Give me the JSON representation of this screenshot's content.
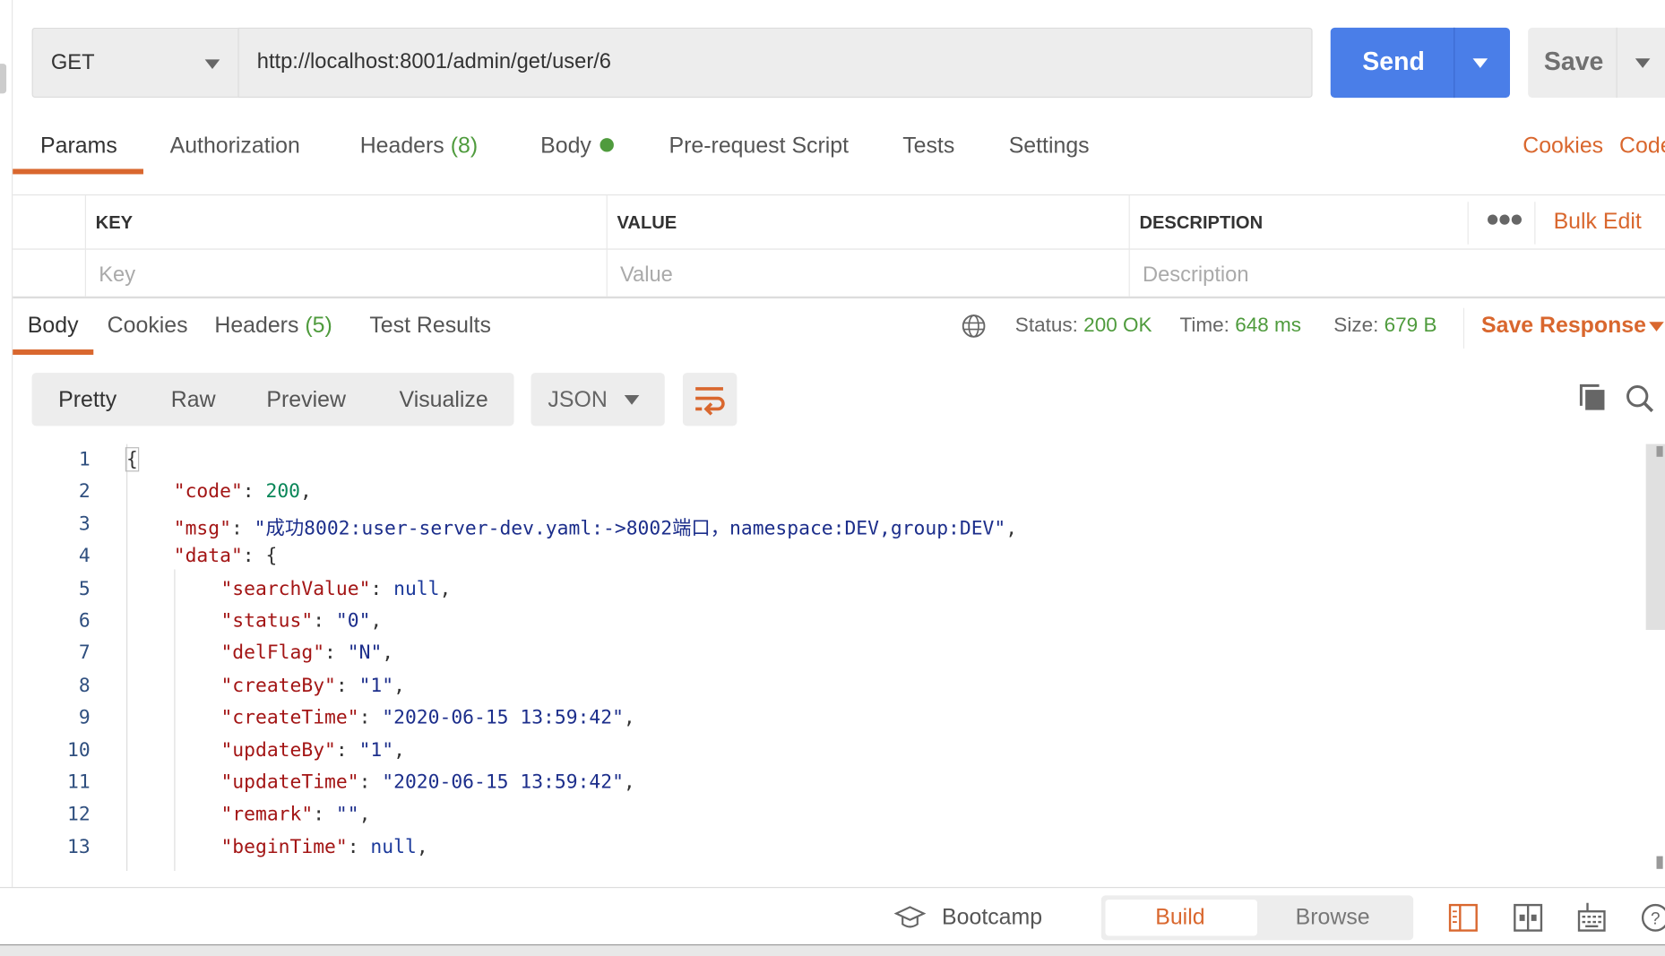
{
  "request": {
    "method": "GET",
    "url": "http://localhost:8001/admin/get/user/6",
    "send_label": "Send",
    "save_label": "Save",
    "send_color": "#4a7ee8"
  },
  "request_tabs": [
    {
      "label": "Params",
      "active": true
    },
    {
      "label": "Authorization"
    },
    {
      "label": "Headers",
      "count": "(8)"
    },
    {
      "label": "Body",
      "dot": true
    },
    {
      "label": "Pre-request Script"
    },
    {
      "label": "Tests"
    },
    {
      "label": "Settings"
    }
  ],
  "request_links": {
    "cookies": "Cookies",
    "code": "Code"
  },
  "params_table": {
    "headers": [
      "KEY",
      "VALUE",
      "DESCRIPTION"
    ],
    "bulk_edit": "Bulk Edit",
    "placeholders": {
      "key": "Key",
      "value": "Value",
      "description": "Description"
    }
  },
  "response_tabs": [
    {
      "label": "Body",
      "active": true
    },
    {
      "label": "Cookies"
    },
    {
      "label": "Headers",
      "count": "(5)"
    },
    {
      "label": "Test Results"
    }
  ],
  "response_meta": {
    "status_label": "Status:",
    "status": "200 OK",
    "time_label": "Time:",
    "time": "648 ms",
    "size_label": "Size:",
    "size": "679 B",
    "save_response": "Save Response"
  },
  "view_modes": [
    "Pretty",
    "Raw",
    "Preview",
    "Visualize"
  ],
  "format": "JSON",
  "code_lines": [
    {
      "n": "1",
      "parts": [
        [
          "p",
          "{"
        ]
      ]
    },
    {
      "n": "2",
      "parts": [
        [
          "k",
          "\"code\""
        ],
        [
          "p",
          ": "
        ],
        [
          "n",
          "200"
        ],
        [
          "p",
          ","
        ]
      ]
    },
    {
      "n": "3",
      "parts": [
        [
          "k",
          "\"msg\""
        ],
        [
          "p",
          ": "
        ],
        [
          "s",
          "\"成功8002:user-server-dev.yaml:->8002端口，namespace:DEV,group:DEV\""
        ],
        [
          "p",
          ","
        ]
      ]
    },
    {
      "n": "4",
      "parts": [
        [
          "k",
          "\"data\""
        ],
        [
          "p",
          ": {"
        ]
      ]
    },
    {
      "n": "5",
      "parts": [
        [
          "k",
          "\"searchValue\""
        ],
        [
          "p",
          ": "
        ],
        [
          "nl",
          "null"
        ],
        [
          "p",
          ","
        ]
      ]
    },
    {
      "n": "6",
      "parts": [
        [
          "k",
          "\"status\""
        ],
        [
          "p",
          ": "
        ],
        [
          "s",
          "\"0\""
        ],
        [
          "p",
          ","
        ]
      ]
    },
    {
      "n": "7",
      "parts": [
        [
          "k",
          "\"delFlag\""
        ],
        [
          "p",
          ": "
        ],
        [
          "s",
          "\"N\""
        ],
        [
          "p",
          ","
        ]
      ]
    },
    {
      "n": "8",
      "parts": [
        [
          "k",
          "\"createBy\""
        ],
        [
          "p",
          ": "
        ],
        [
          "s",
          "\"1\""
        ],
        [
          "p",
          ","
        ]
      ]
    },
    {
      "n": "9",
      "parts": [
        [
          "k",
          "\"createTime\""
        ],
        [
          "p",
          ": "
        ],
        [
          "s",
          "\"2020-06-15 13:59:42\""
        ],
        [
          "p",
          ","
        ]
      ]
    },
    {
      "n": "10",
      "parts": [
        [
          "k",
          "\"updateBy\""
        ],
        [
          "p",
          ": "
        ],
        [
          "s",
          "\"1\""
        ],
        [
          "p",
          ","
        ]
      ]
    },
    {
      "n": "11",
      "parts": [
        [
          "k",
          "\"updateTime\""
        ],
        [
          "p",
          ": "
        ],
        [
          "s",
          "\"2020-06-15 13:59:42\""
        ],
        [
          "p",
          ","
        ]
      ]
    },
    {
      "n": "12",
      "parts": [
        [
          "k",
          "\"remark\""
        ],
        [
          "p",
          ": "
        ],
        [
          "s",
          "\"\""
        ],
        [
          "p",
          ","
        ]
      ]
    },
    {
      "n": "13",
      "parts": [
        [
          "k",
          "\"beginTime\""
        ],
        [
          "p",
          ": "
        ],
        [
          "nl",
          "null"
        ],
        [
          "p",
          ","
        ]
      ]
    }
  ],
  "footer": {
    "bootcamp": "Bootcamp",
    "build": "Build",
    "browse": "Browse"
  },
  "colors": {
    "accent": "#d9672e",
    "success": "#4f9b3d",
    "send": "#4a7ee8"
  }
}
